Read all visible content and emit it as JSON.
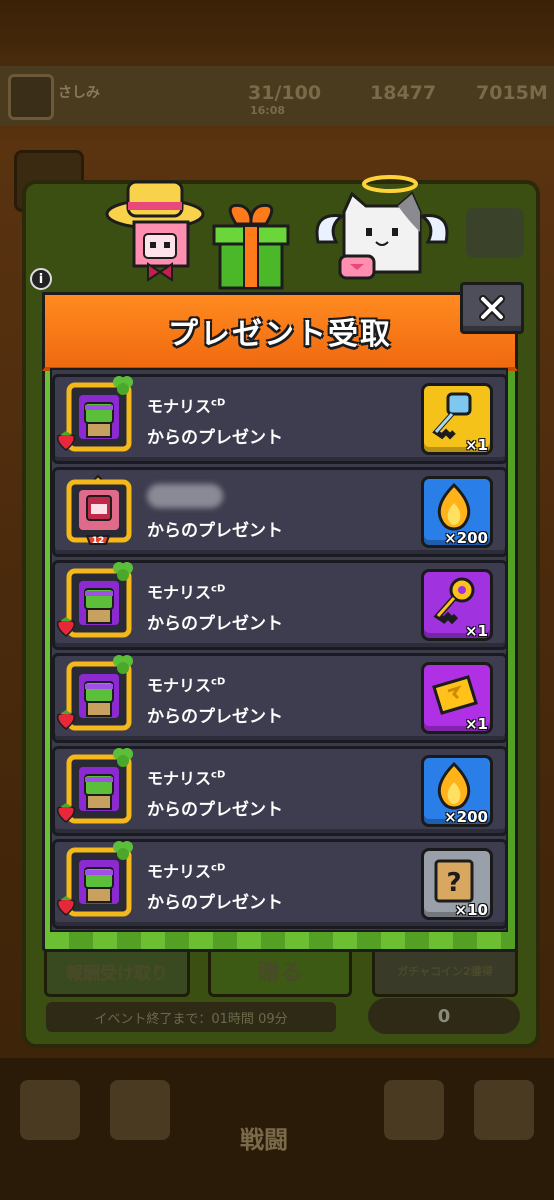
{
  "background": {
    "player_name": "さしみ",
    "stamina": "31/100",
    "stamina_timer": "16:08",
    "gems": "18477",
    "gold": "7015M",
    "reward_button": "報酬受け取り",
    "give_button": "贈る",
    "gacha_button": "ガチャコイン2獲得",
    "event_timer": "イベント終了まで：01時間 09分",
    "coin_count": "0",
    "battle_label": "戦闘"
  },
  "modal": {
    "title": "プレゼント受取",
    "close_label": "✕",
    "info_label": "i"
  },
  "presents": [
    {
      "sender": "モナリス",
      "sender_tag": "cD",
      "from_text": "からのプレゼント",
      "item_icon": "key-icon",
      "item_color": "#f5c21a",
      "qty": "×1"
    },
    {
      "sender": "",
      "sender_tag": "",
      "from_text": "からのプレゼント",
      "item_icon": "flame-icon",
      "item_color": "#2a7ee8",
      "qty": "×200",
      "level_badge": "12"
    },
    {
      "sender": "モナリス",
      "sender_tag": "cD",
      "from_text": "からのプレゼント",
      "item_icon": "gold-key-icon",
      "item_color": "#a032e0",
      "qty": "×1"
    },
    {
      "sender": "モナリス",
      "sender_tag": "cD",
      "from_text": "からのプレゼント",
      "item_icon": "ticket-icon",
      "item_color": "#b030e6",
      "qty": "×1"
    },
    {
      "sender": "モナリス",
      "sender_tag": "cD",
      "from_text": "からのプレゼント",
      "item_icon": "flame-icon",
      "item_color": "#2a7ee8",
      "qty": "×200"
    },
    {
      "sender": "モナリス",
      "sender_tag": "cD",
      "from_text": "からのプレゼント",
      "item_icon": "mystery-scroll-icon",
      "item_color": "#9aa0aa",
      "qty": "×10"
    }
  ]
}
